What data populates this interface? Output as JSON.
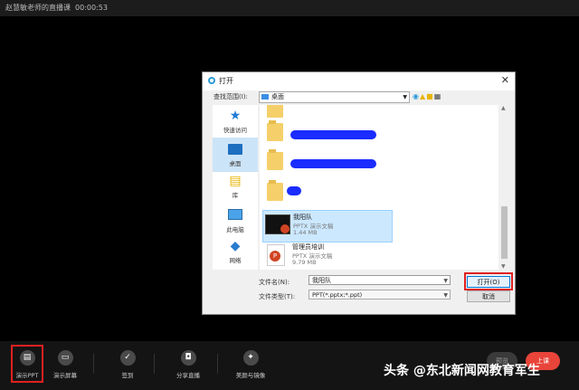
{
  "topbar": {
    "title": "赵慧敏老师的直播课",
    "timer": "00:00:53"
  },
  "dialog": {
    "title": "打开",
    "look_in_label": "查找范围(I):",
    "look_in_value": "桌面",
    "places": [
      {
        "label": "快速访问",
        "icon": "star-icon"
      },
      {
        "label": "桌面",
        "icon": "desktop-icon"
      },
      {
        "label": "库",
        "icon": "library-icon"
      },
      {
        "label": "此电脑",
        "icon": "computer-icon"
      },
      {
        "label": "网络",
        "icon": "network-icon"
      }
    ],
    "files": [
      {
        "name": "我阳队",
        "type": "PPTX 演示文稿",
        "size": "1.44 MB"
      },
      {
        "name": "管理员培训",
        "type": "PPTX 演示文稿",
        "size": "9.79 MB"
      }
    ],
    "filename_label": "文件名(N):",
    "filename_value": "我阳队",
    "filetype_label": "文件类型(T):",
    "filetype_value": "PPT(*.pptx;*.ppt)",
    "open_button": "打开(O)",
    "cancel_button": "取消"
  },
  "toolbar": {
    "items": [
      {
        "label": "演示PPT"
      },
      {
        "label": "演示屏幕"
      },
      {
        "label": "签到"
      },
      {
        "label": "分享直播"
      },
      {
        "label": "美颜与镜像"
      }
    ],
    "preview_label": "预览",
    "start_label": "上课"
  },
  "watermark": "头条 @东北新闻网教育军生",
  "colors": {
    "accent": "#e8443a",
    "highlight": "#e02020",
    "selection": "#cce8ff"
  }
}
